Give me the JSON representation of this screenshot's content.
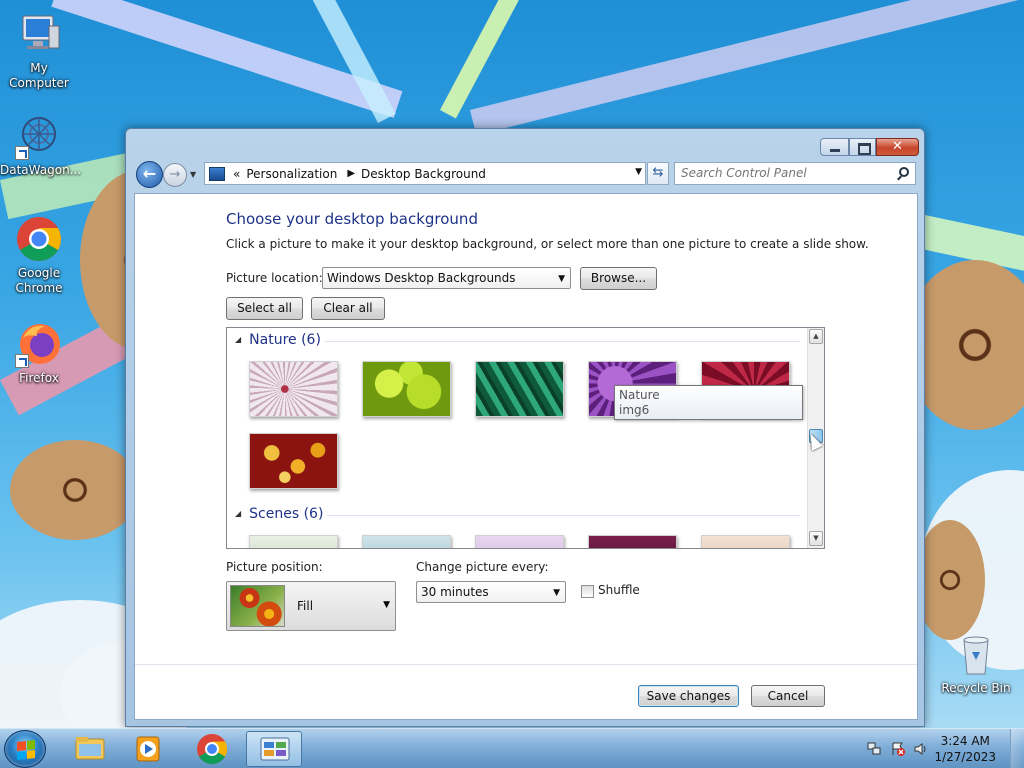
{
  "desktop": {
    "icons": [
      {
        "label": "My Computer",
        "icon": "computer-icon"
      },
      {
        "label": "DataWagon...",
        "icon": "datawagon-icon"
      },
      {
        "label": "Google Chrome",
        "icon": "chrome-icon"
      },
      {
        "label": "Firefox",
        "icon": "firefox-icon"
      },
      {
        "label": "Recycle Bin",
        "icon": "recycle-bin-icon"
      }
    ]
  },
  "window": {
    "caption": {
      "minimize": "minimize-icon",
      "maximize": "maximize-icon",
      "close": "close-icon"
    },
    "address": {
      "crumbs": [
        "Personalization",
        "Desktop Background"
      ],
      "prefix": "«"
    },
    "search": {
      "placeholder": "Search Control Panel"
    }
  },
  "page": {
    "title": "Choose your desktop background",
    "description": "Click a picture to make it your desktop background, or select more than one picture to create a slide show.",
    "picture_location_label": "Picture location:",
    "picture_location_value": "Windows Desktop Backgrounds",
    "browse_label": "Browse...",
    "select_all_label": "Select all",
    "clear_all_label": "Clear all",
    "groups": [
      {
        "name": "Nature (6)"
      },
      {
        "name": "Scenes (6)"
      }
    ],
    "tooltip": {
      "line1": "Nature",
      "line2": "img6"
    },
    "picture_position_label": "Picture position:",
    "picture_position_value": "Fill",
    "change_every_label": "Change picture every:",
    "change_every_value": "30 minutes",
    "shuffle_label": "Shuffle",
    "shuffle_checked": false,
    "save_label": "Save changes",
    "cancel_label": "Cancel"
  },
  "taskbar": {
    "time": "3:24 AM",
    "date": "1/27/2023",
    "items": [
      "explorer-icon",
      "media-player-icon",
      "chrome-icon",
      "control-panel-icon"
    ],
    "tray": [
      "network-icon",
      "action-center-icon",
      "volume-icon"
    ]
  }
}
